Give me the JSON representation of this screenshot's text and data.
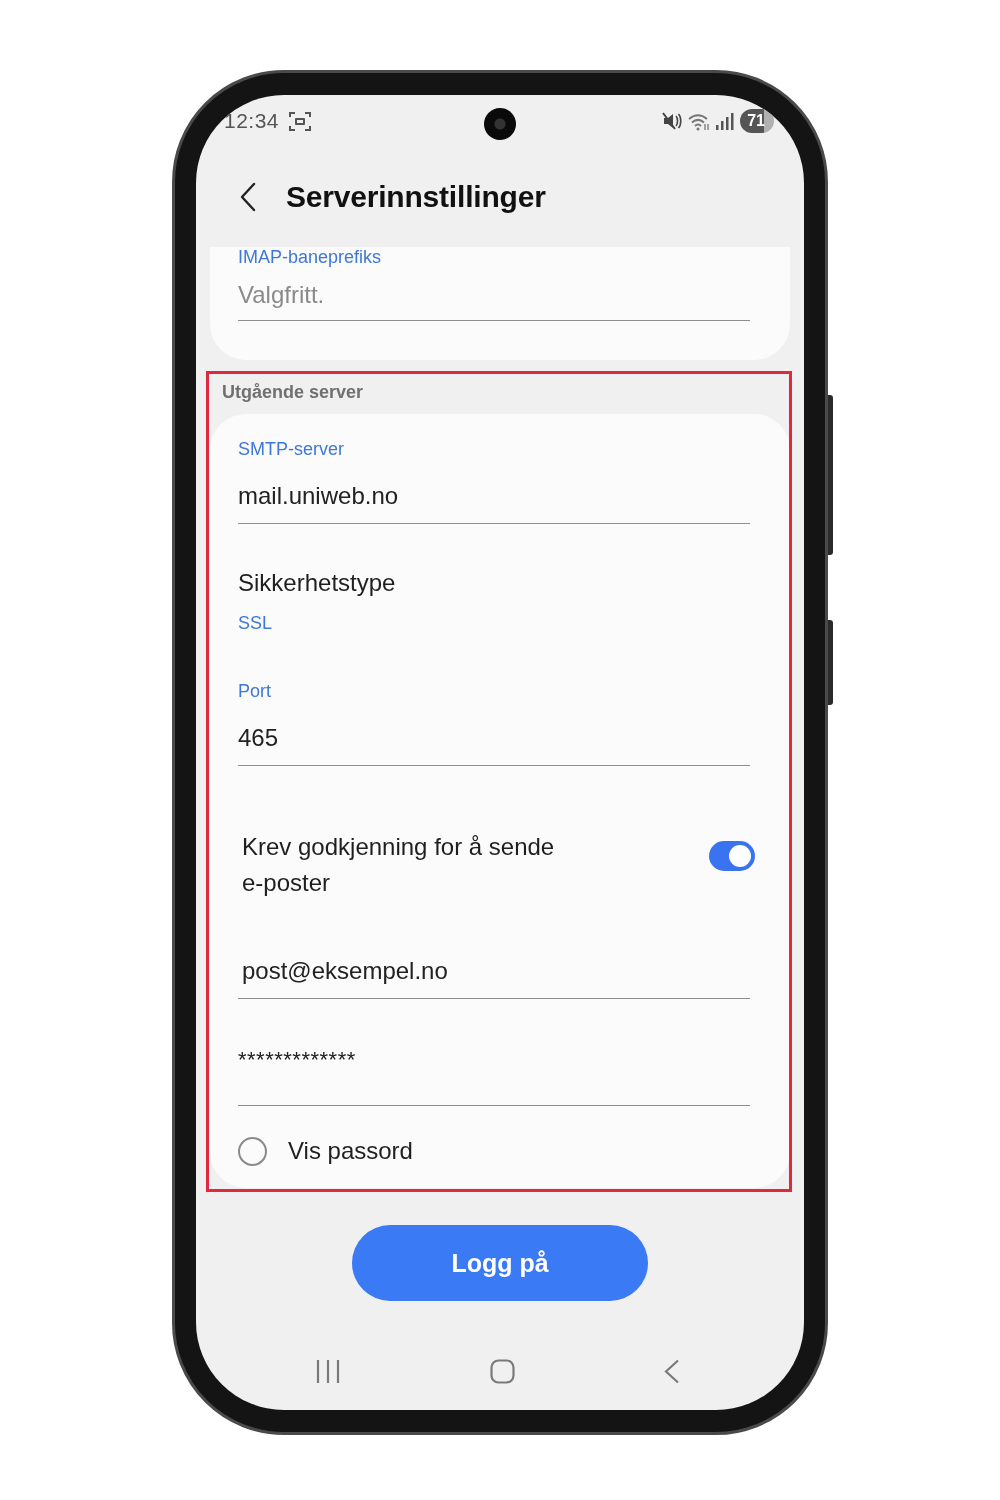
{
  "status_bar": {
    "time": "12:34",
    "battery": "71"
  },
  "header": {
    "title": "Serverinnstillinger"
  },
  "incoming_card": {
    "fields": [
      {
        "label": "IMAP-baneprefiks",
        "placeholder": "Valgfritt."
      }
    ]
  },
  "outgoing_server": {
    "heading": "Utgående server",
    "items": [
      {
        "kind": "field",
        "label": "SMTP-server",
        "value": "mail.uniweb.no"
      },
      {
        "kind": "select",
        "title": "Sikkerhetstype",
        "value": "SSL"
      },
      {
        "kind": "field",
        "label": "Port",
        "value": "465"
      },
      {
        "kind": "switch",
        "title": "Krev godkjenning for å sende e-poster",
        "on": true
      },
      {
        "kind": "field",
        "value": "post@eksempel.no"
      },
      {
        "kind": "password",
        "value": "*************"
      },
      {
        "kind": "radio",
        "title": "Vis passord",
        "checked": false
      }
    ]
  },
  "login_button": {
    "label": "Logg på"
  }
}
